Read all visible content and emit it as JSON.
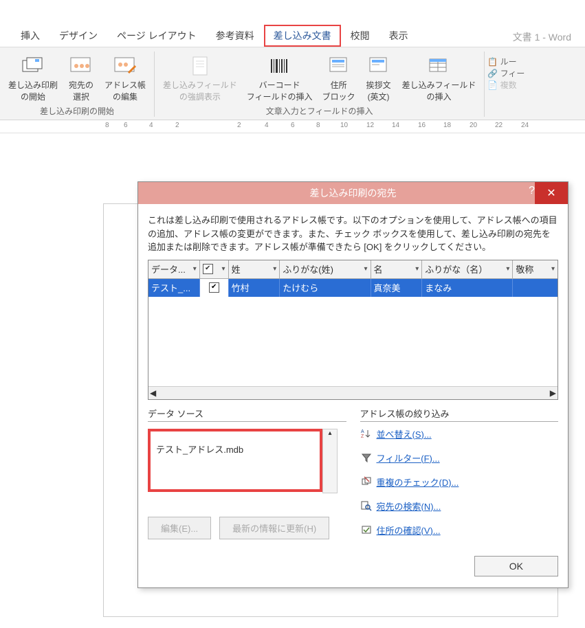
{
  "app_title": "文書 1 - Word",
  "tabs": {
    "insert": "挿入",
    "design": "デザイン",
    "layout": "ページ レイアウト",
    "reference": "参考資料",
    "mailings": "差し込み文書",
    "review": "校閲",
    "view": "表示"
  },
  "ribbon": {
    "start_merge": "差し込み印刷\nの開始",
    "select_recipient": "宛先の\n選択",
    "edit_list": "アドレス帳\nの編集",
    "highlight": "差し込みフィールド\nの強調表示",
    "barcode": "バーコード\nフィールドの挿入",
    "address_block": "住所\nブロック",
    "greeting": "挨拶文\n(英文)",
    "insert_field": "差し込みフィールド\nの挿入",
    "group1": "差し込み印刷の開始",
    "group2": "文章入力とフィールドの挿入",
    "side_rules": "ルー",
    "side_fields": "フィー",
    "side_multi": "複数"
  },
  "dialog": {
    "title": "差し込み印刷の宛先",
    "description": "これは差し込み印刷で使用されるアドレス帳です。以下のオプションを使用して、アドレス帳への項目の追加、アドレス帳の変更ができます。また、チェック ボックスを使用して、差し込み印刷の宛先を追加または削除できます。アドレス帳が準備できたら [OK] をクリックしてください。",
    "headers": {
      "data": "データ...",
      "chk": "✔",
      "sei": "姓",
      "furi_sei": "ふりがな(姓)",
      "mei": "名",
      "furi_mei": "ふりがな（名）",
      "keisho": "敬称"
    },
    "row": {
      "data": "テスト_...",
      "chk": "✔",
      "sei": "竹村",
      "furi_sei": "たけむら",
      "mei": "真奈美",
      "furi_mei": "まなみ",
      "keisho": ""
    },
    "datasource_label": "データ ソース",
    "datasource_file": "テスト_アドレス.mdb",
    "edit_btn": "編集(E)...",
    "refresh_btn": "最新の情報に更新(H)",
    "filter_label": "アドレス帳の絞り込み",
    "links": {
      "sort": "並べ替え(S)...",
      "filter": "フィルター(F)...",
      "dup": "重複のチェック(D)...",
      "find": "宛先の検索(N)...",
      "validate": "住所の確認(V)..."
    },
    "ok": "OK"
  }
}
